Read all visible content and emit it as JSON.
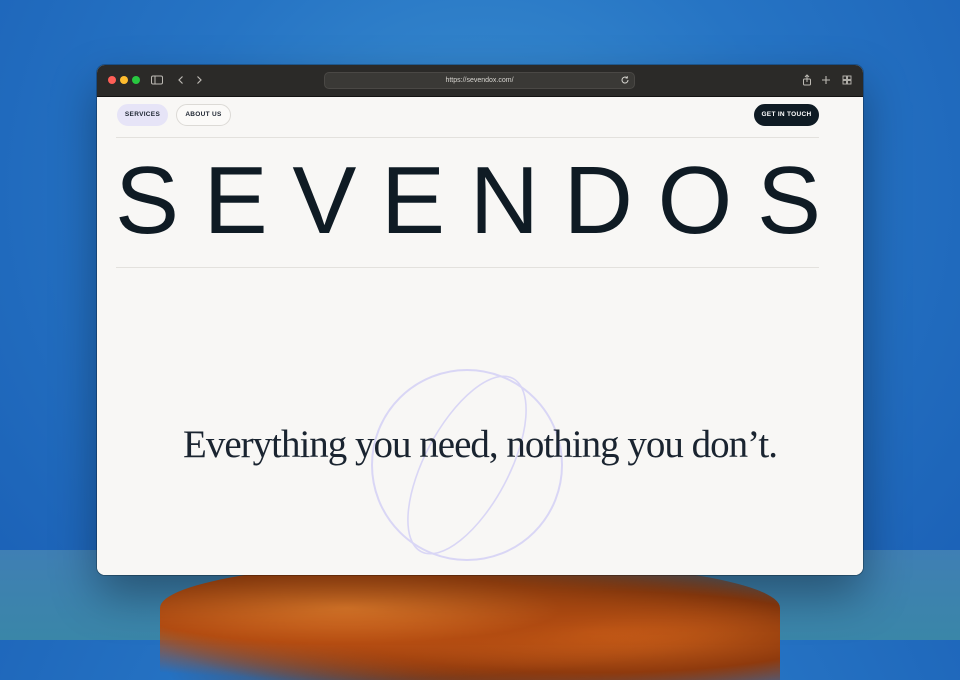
{
  "browser": {
    "url": "https://sevendox.com/"
  },
  "nav": {
    "services_label": "SERVICES",
    "about_label": "ABOUT US",
    "cta_label": "GET IN TOUCH"
  },
  "hero": {
    "wordmark": "SEVENDOS",
    "headline": "Everything you need, nothing you don’t."
  },
  "colors": {
    "ink": "#0f1b24",
    "pill_active": "#e6e4f7",
    "page_bg": "#f8f7f5",
    "ring": "#d9d6f5"
  },
  "icons": [
    "sidebar-icon",
    "chevron-left-icon",
    "chevron-right-icon",
    "reload-icon",
    "share-icon",
    "plus-icon",
    "tabs-grid-icon"
  ]
}
